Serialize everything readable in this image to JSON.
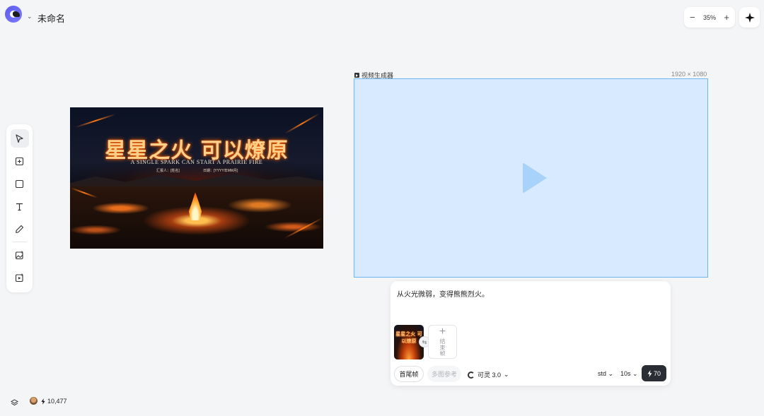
{
  "header": {
    "title": "未命名",
    "zoom_level": "35%",
    "zoom_out_symbol": "−",
    "zoom_in_symbol": "+"
  },
  "toolbar": {
    "tools": [
      {
        "name": "select-tool",
        "icon": "cursor-arrow-icon",
        "active": true
      },
      {
        "name": "add-frame-tool",
        "icon": "plus-square-icon",
        "active": false
      },
      {
        "name": "rectangle-tool",
        "icon": "square-icon",
        "active": false
      },
      {
        "name": "text-tool",
        "icon": "text-T-icon",
        "active": false
      },
      {
        "name": "pen-tool",
        "icon": "pen-icon",
        "active": false
      },
      {
        "name": "image-generator-tool",
        "icon": "image-plus-icon",
        "active": false
      },
      {
        "name": "video-generator-tool",
        "icon": "video-plus-icon",
        "active": false
      }
    ]
  },
  "poster": {
    "title": "星星之火 可以燎原",
    "subtitle": "A SINGLE SPARK CAN START A PRAIRIE FIRE",
    "reporter": "汇报人：[姓名]",
    "date": "日期：[YYYY年MM月]"
  },
  "video_generator": {
    "label": "视频生成器",
    "dimensions": "1920 × 1080"
  },
  "prompt_panel": {
    "prompt": "从火光微弱，变得熊熊烈火。",
    "thumb_title": "星星之火 可以燎原",
    "end_frame_label": "结束帧",
    "mode_first_last": "首尾帧",
    "mode_multi_ref": "多图参考",
    "model": "可灵 3.0",
    "quality": "std",
    "duration": "10s",
    "cost": "70"
  },
  "footer": {
    "credits": "10,477"
  },
  "colors": {
    "accent_blue": "#6fb6ee",
    "frame_fill": "#d7eaff",
    "generate_button": "#2a2d34",
    "logo": "#5d5cf0"
  }
}
